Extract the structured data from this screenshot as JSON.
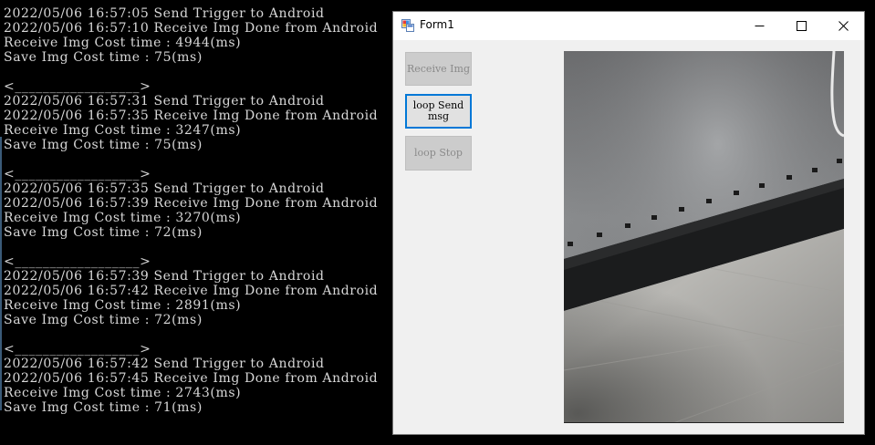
{
  "console": {
    "lines": [
      "2022/05/06 16:57:05 Send Trigger to Android",
      "2022/05/06 16:57:10 Receive Img Done from Android",
      "Receive Img Cost time : 4944(ms)",
      "Save Img Cost time : 75(ms)",
      "",
      "<__________________>",
      "2022/05/06 16:57:31 Send Trigger to Android",
      "2022/05/06 16:57:35 Receive Img Done from Android",
      "Receive Img Cost time : 3247(ms)",
      "Save Img Cost time : 75(ms)",
      "",
      "<__________________>",
      "2022/05/06 16:57:35 Send Trigger to Android",
      "2022/05/06 16:57:39 Receive Img Done from Android",
      "Receive Img Cost time : 3270(ms)",
      "Save Img Cost time : 72(ms)",
      "",
      "<__________________>",
      "2022/05/06 16:57:39 Send Trigger to Android",
      "2022/05/06 16:57:42 Receive Img Done from Android",
      "Receive Img Cost time : 2891(ms)",
      "Save Img Cost time : 72(ms)",
      "",
      "<__________________>",
      "2022/05/06 16:57:42 Send Trigger to Android",
      "2022/05/06 16:57:45 Receive Img Done from Android",
      "Receive Img Cost time : 2743(ms)",
      "Save Img Cost time : 71(ms)"
    ],
    "colors": {
      "background": "#000000",
      "text": "#d8d8d8"
    }
  },
  "form": {
    "title": "Form1",
    "app_icon": "winforms-app-icon",
    "caption_buttons": {
      "minimize_icon": "minimize-icon",
      "maximize_icon": "maximize-icon",
      "close_icon": "close-icon"
    },
    "buttons": {
      "receive_img": "Receive Img",
      "loop_send_msg": "loop Send msg",
      "loop_stop": "loop Stop"
    },
    "picture": {
      "icon": "camera-photo-floor-wall"
    },
    "colors": {
      "client_background": "#f0f0f0",
      "focus_border": "#0078d7",
      "disabled_button": "#cccccc"
    }
  }
}
